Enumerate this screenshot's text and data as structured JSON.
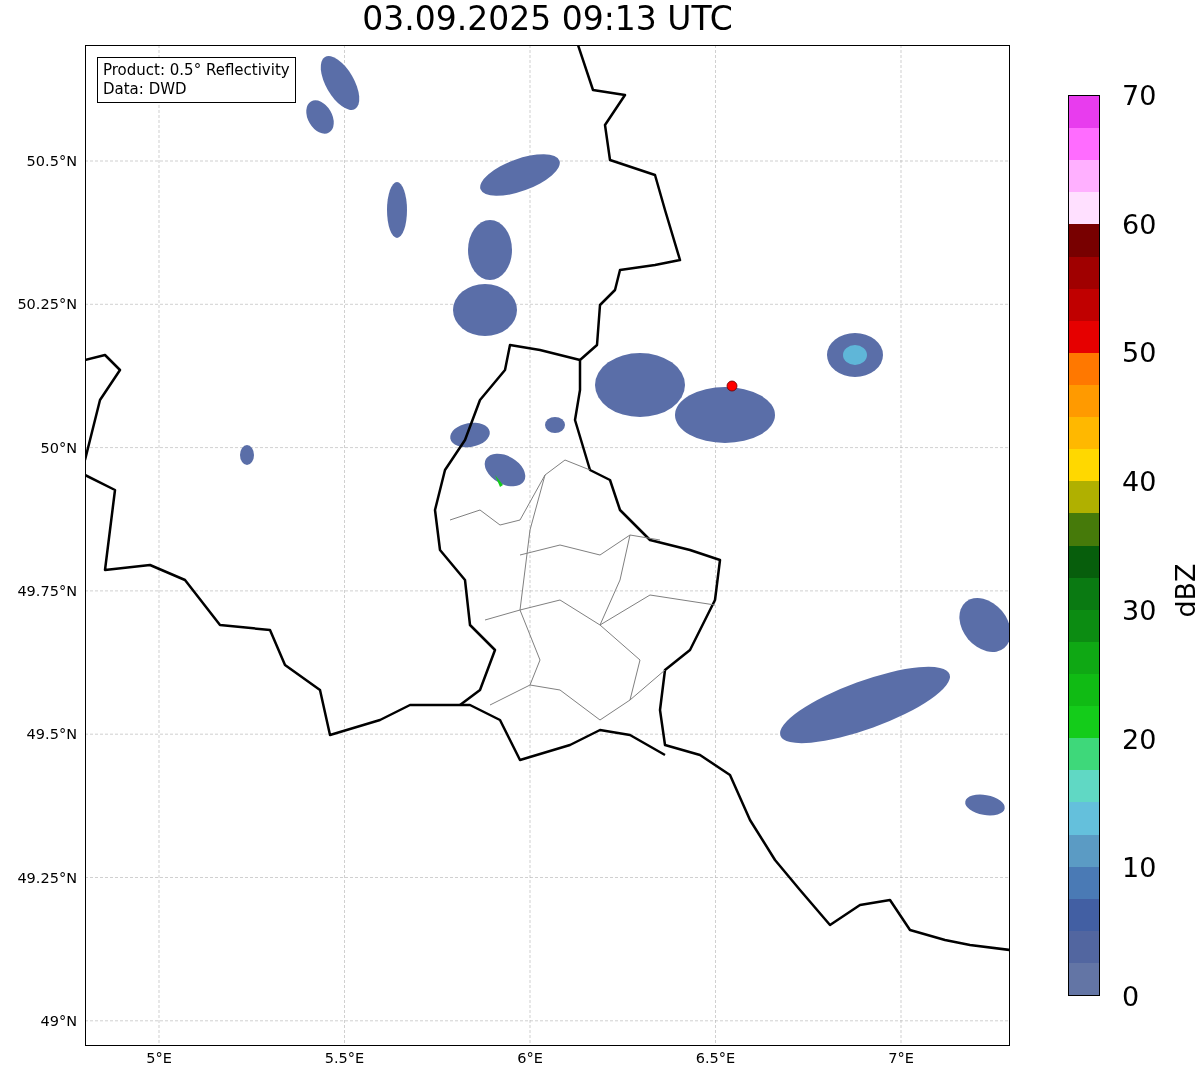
{
  "title": "03.09.2025 09:13 UTC",
  "map": {
    "legend": [
      "Product: 0.5° Reflectivity",
      "Data: DWD"
    ],
    "lat_labels": [
      "50.5°N",
      "50.25°N",
      "50°N",
      "49.75°N",
      "49.5°N",
      "49.25°N",
      "49°N"
    ],
    "lon_labels": [
      "5°E",
      "5.5°E",
      "6°E",
      "6.5°E",
      "7°E"
    ]
  },
  "colorbar": {
    "label": "dBZ",
    "ticks": [
      "70",
      "60",
      "50",
      "40",
      "30",
      "20",
      "10",
      "0"
    ],
    "segments": [
      {
        "color": "#e83cee"
      },
      {
        "color": "#ff6cff"
      },
      {
        "color": "#ffb0ff"
      },
      {
        "color": "#ffe0ff"
      },
      {
        "color": "#780000"
      },
      {
        "color": "#a00000"
      },
      {
        "color": "#c00000"
      },
      {
        "color": "#e60000"
      },
      {
        "color": "#ff7800"
      },
      {
        "color": "#ff9a00"
      },
      {
        "color": "#ffb800"
      },
      {
        "color": "#ffd800"
      },
      {
        "color": "#b0b000"
      },
      {
        "color": "#467a0a"
      },
      {
        "color": "#075e0c"
      },
      {
        "color": "#0a7a12"
      },
      {
        "color": "#0c8c12"
      },
      {
        "color": "#0fa814"
      },
      {
        "color": "#10bb14"
      },
      {
        "color": "#14cc1a"
      },
      {
        "color": "#3ed87a"
      },
      {
        "color": "#60d8c4"
      },
      {
        "color": "#64c0dc"
      },
      {
        "color": "#5b9bc4"
      },
      {
        "color": "#4a7ab5"
      },
      {
        "color": "#425fa3"
      },
      {
        "color": "#5266a0"
      },
      {
        "color": "#6375a5"
      }
    ]
  }
}
